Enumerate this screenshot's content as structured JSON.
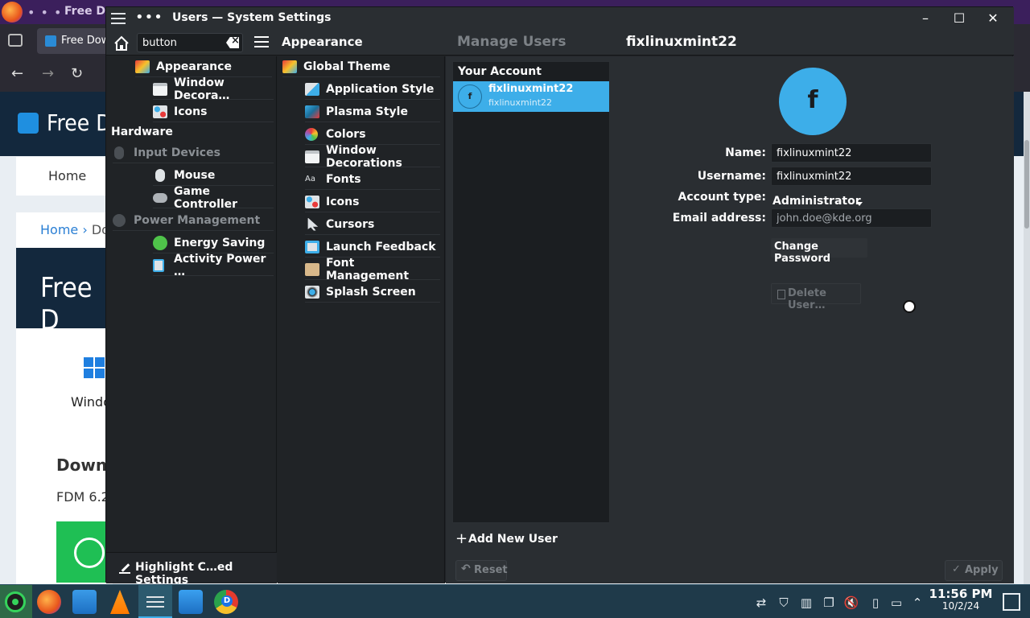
{
  "browser": {
    "window_title": "Free Do",
    "tab_title": "Free Dow",
    "brand": "Free D",
    "home_nav": "Home",
    "crumb_home": "Home",
    "crumb_rest": "Do",
    "hero": "Free D",
    "os_label": "Windo",
    "download_heading": "Downl",
    "version_text": "FDM 6.2"
  },
  "window": {
    "title": "Users — System Settings"
  },
  "toolbar": {
    "search_value": "button",
    "sidebar_header": "Appearance",
    "page_header": "Manage Users",
    "user_header": "fixlinuxmint22"
  },
  "sidebar": {
    "items": [
      {
        "label": "Appearance",
        "icon": "appearance-icon"
      },
      {
        "label": "Window Decora…",
        "icon": "window-icon"
      },
      {
        "label": "Icons",
        "icon": "icons-icon"
      }
    ],
    "hardware_header": "Hardware",
    "hardware": [
      {
        "label": "Input Devices",
        "icon": "mouse-icon"
      },
      {
        "label": "Mouse",
        "icon": "mouse-icon"
      },
      {
        "label": "Game Controller",
        "icon": "gamepad-icon"
      },
      {
        "label": "Power Management",
        "icon": "power-icon"
      },
      {
        "label": "Energy Saving",
        "icon": "battery-icon"
      },
      {
        "label": "Activity Power …",
        "icon": "activity-icon"
      }
    ],
    "footer_label": "Highlight C…ed Settings"
  },
  "appearance": {
    "items": [
      {
        "label": "Global Theme",
        "icon": "global-theme-icon"
      },
      {
        "label": "Application Style",
        "icon": "brush-icon"
      },
      {
        "label": "Plasma Style",
        "icon": "plasma-icon"
      },
      {
        "label": "Colors",
        "icon": "colors-icon"
      },
      {
        "label": "Window Decorations",
        "icon": "window-icon"
      },
      {
        "label": "Fonts",
        "icon": "fonts-icon"
      },
      {
        "label": "Icons",
        "icon": "icons-icon"
      },
      {
        "label": "Cursors",
        "icon": "cursor-icon"
      },
      {
        "label": "Launch Feedback",
        "icon": "launch-icon"
      },
      {
        "label": "Font Management",
        "icon": "font-management-icon"
      },
      {
        "label": "Splash Screen",
        "icon": "splash-icon"
      }
    ]
  },
  "users": {
    "section_title": "Your Account",
    "list": [
      {
        "avatar_letter": "f",
        "name": "fixlinuxmint22",
        "username": "fixlinuxmint22"
      }
    ],
    "add_label": "Add New User",
    "reset_label": "Reset",
    "apply_label": "Apply"
  },
  "details": {
    "avatar_letter": "f",
    "name_label": "Name:",
    "name_value": "fixlinuxmint22",
    "username_label": "Username:",
    "username_value": "fixlinuxmint22",
    "account_type_label": "Account type:",
    "account_type_value": "Administrator",
    "email_label": "Email address:",
    "email_placeholder": "john.doe@kde.org",
    "change_password": "Change Password",
    "delete_user": "Delete User…"
  },
  "taskbar": {
    "time": "11:56 PM",
    "date": "10/2/24"
  },
  "colors": {
    "accent": "#3daee9",
    "window_bg": "#202326",
    "titlebar": "#2a2e32"
  }
}
